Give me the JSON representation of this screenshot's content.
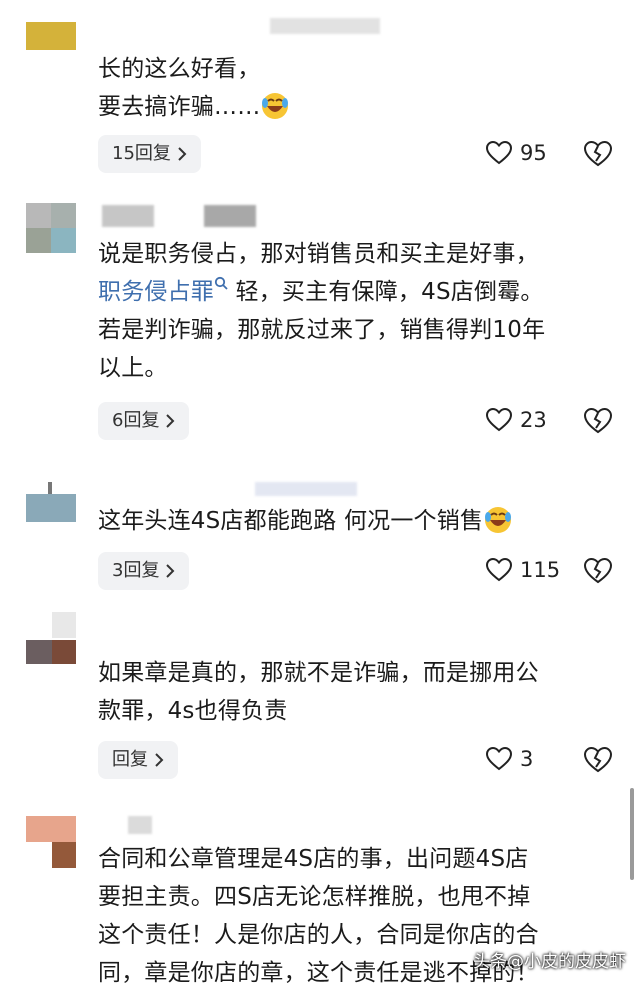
{
  "comments": [
    {
      "lines": [
        "长的这么好看，",
        "要去搞诈骗……"
      ],
      "reply_label": "15回复",
      "likes": "95"
    },
    {
      "line1": "说是职务侵占，那对销售员和买主是好事，",
      "line2_link": "职务侵占罪",
      "line2_rest": " 轻，买主有保障，4S店倒霉。",
      "line3": "若是判诈骗，那就反过来了，销售得判10年",
      "line4": "以上。",
      "reply_label": "6回复",
      "likes": "23"
    },
    {
      "lines": [
        "这年头连4S店都能跑路 何况一个销售"
      ],
      "reply_label": "3回复",
      "likes": "115"
    },
    {
      "lines": [
        "如果章是真的，那就不是诈骗，而是挪用公",
        "款罪，4s也得负责"
      ],
      "reply_label": "回复",
      "likes": "3"
    },
    {
      "lines": [
        "合同和公章管理是4S店的事，出问题4S店",
        "要担主责。四S店无论怎样推脱，也甩不掉",
        "这个责任！人是你店的人，合同是你店的合",
        "同，章是你店的章，这个责任是逃不掉的！"
      ]
    }
  ],
  "watermark": "头条@小皮的皮皮虾",
  "icons": {
    "like": "heart-outline-icon",
    "dislike": "broken-heart-icon",
    "chevron": "chevron-right-icon",
    "search": "search-icon",
    "emoji": "laughing-crying-emoji"
  }
}
